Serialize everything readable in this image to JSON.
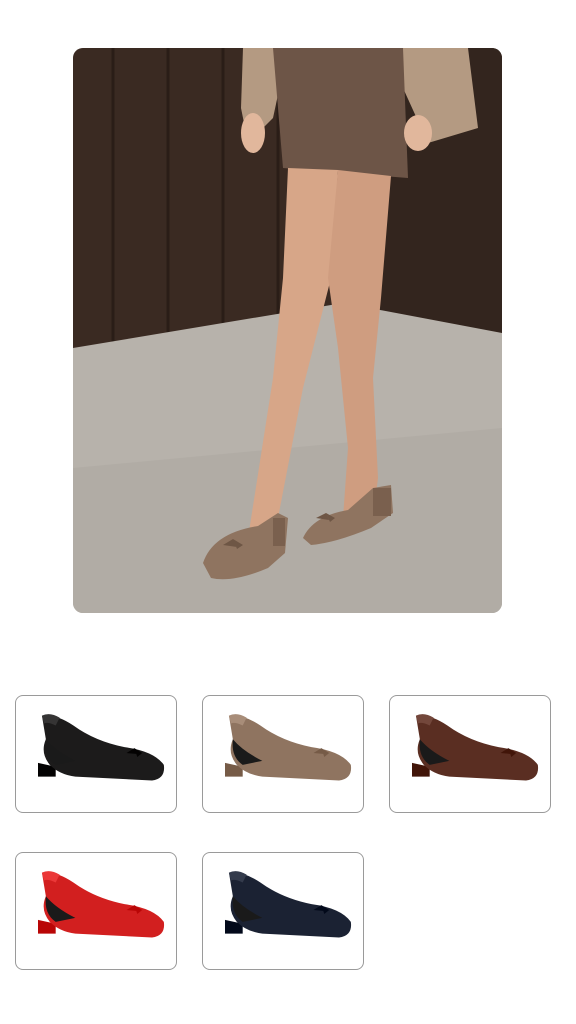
{
  "hero": {
    "icon": "product-hero-photo",
    "shoe_color": "#8f7460"
  },
  "variants": [
    {
      "color": "#1c1b1b",
      "selected": false
    },
    {
      "color": "#8f7460",
      "selected": true
    },
    {
      "color": "#5a2e22",
      "selected": false
    },
    {
      "color": "#d21f1f",
      "selected": false
    },
    {
      "color": "#1b2233",
      "selected": false
    }
  ]
}
